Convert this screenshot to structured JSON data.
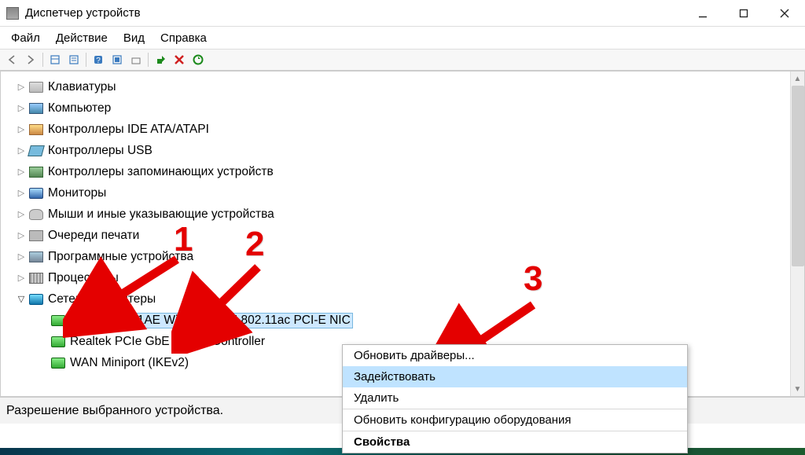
{
  "titlebar": {
    "title": "Диспетчер устройств"
  },
  "menubar": {
    "items": [
      "Файл",
      "Действие",
      "Вид",
      "Справка"
    ]
  },
  "tree": {
    "items": [
      {
        "label": "Клавиатуры",
        "icon": "icn-kbd",
        "expander": "closed"
      },
      {
        "label": "Компьютер",
        "icon": "icn-pc",
        "expander": "closed"
      },
      {
        "label": "Контроллеры IDE ATA/ATAPI",
        "icon": "icn-ide",
        "expander": "closed"
      },
      {
        "label": "Контроллеры USB",
        "icon": "icn-usb",
        "expander": "closed"
      },
      {
        "label": "Контроллеры запоминающих устройств",
        "icon": "icn-storage",
        "expander": "closed"
      },
      {
        "label": "Мониторы",
        "icon": "icn-monitor",
        "expander": "closed"
      },
      {
        "label": "Мыши и иные указывающие устройства",
        "icon": "icn-mouse",
        "expander": "closed"
      },
      {
        "label": "Очереди печати",
        "icon": "icn-print",
        "expander": "closed"
      },
      {
        "label": "Программные устройства",
        "icon": "icn-soft",
        "expander": "closed"
      },
      {
        "label": "Процессоры",
        "icon": "icn-cpu",
        "expander": "closed"
      },
      {
        "label": "Сетевые адаптеры",
        "icon": "icn-net",
        "expander": "open",
        "children": [
          {
            "label": "Realtek 8821AE Wireless LAN 802.11ac PCI-E NIC",
            "icon": "icn-adapter",
            "selected": true
          },
          {
            "label": "Realtek PCIe GbE Family Controller",
            "icon": "icn-adapter"
          },
          {
            "label": "WAN Miniport (IKEv2)",
            "icon": "icn-adapter"
          }
        ]
      }
    ]
  },
  "statusbar": {
    "text": "Разрешение выбранного устройства."
  },
  "context_menu": {
    "items": [
      {
        "label": "Обновить драйверы...",
        "highlight": false
      },
      {
        "label": "Задействовать",
        "highlight": true
      },
      {
        "label": "Удалить",
        "highlight": false
      },
      {
        "sep": true
      },
      {
        "label": "Обновить конфигурацию оборудования",
        "highlight": false
      },
      {
        "sep": true
      },
      {
        "label": "Свойства",
        "bold": true
      }
    ]
  },
  "annotations": {
    "n1": "1",
    "n2": "2",
    "n3": "3"
  }
}
